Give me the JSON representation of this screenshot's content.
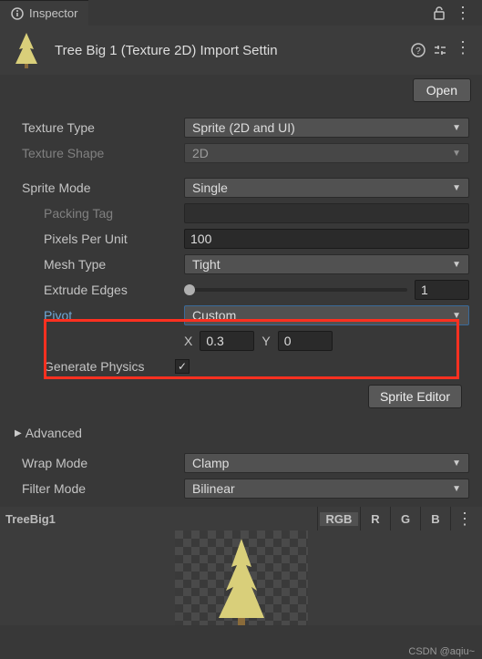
{
  "tab": {
    "name": "Inspector"
  },
  "header": {
    "title": "Tree Big 1 (Texture 2D) Import Settin",
    "open_label": "Open"
  },
  "texture_type": {
    "label": "Texture Type",
    "value": "Sprite (2D and UI)"
  },
  "texture_shape": {
    "label": "Texture Shape",
    "value": "2D"
  },
  "sprite_mode": {
    "label": "Sprite Mode",
    "value": "Single"
  },
  "packing_tag": {
    "label": "Packing Tag",
    "value": ""
  },
  "pixels_per_unit": {
    "label": "Pixels Per Unit",
    "value": "100"
  },
  "mesh_type": {
    "label": "Mesh Type",
    "value": "Tight"
  },
  "extrude_edges": {
    "label": "Extrude Edges",
    "value": "1"
  },
  "pivot": {
    "label": "Pivot",
    "value": "Custom",
    "x_label": "X",
    "x": "0.3",
    "y_label": "Y",
    "y": "0"
  },
  "generate_physics": {
    "label": "Generate Physics",
    "checked": true
  },
  "sprite_editor_label": "Sprite Editor",
  "advanced_label": "Advanced",
  "wrap_mode": {
    "label": "Wrap Mode",
    "value": "Clamp"
  },
  "filter_mode": {
    "label": "Filter Mode",
    "value": "Bilinear"
  },
  "preview": {
    "name": "TreeBig1",
    "channels": {
      "rgb": "RGB",
      "r": "R",
      "g": "G",
      "b": "B"
    }
  },
  "watermark": "CSDN @aqiu~"
}
